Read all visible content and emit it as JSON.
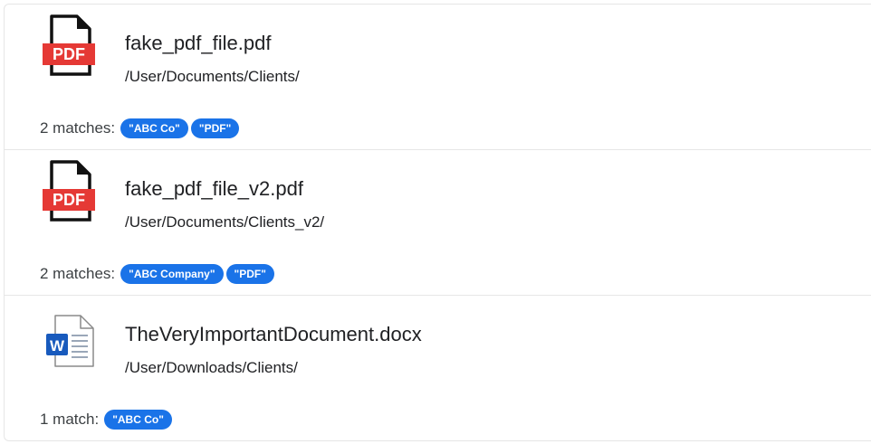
{
  "results": [
    {
      "icon": "pdf-file-icon",
      "icon_badge": "PDF",
      "file_name": "fake_pdf_file.pdf",
      "path": "/User/Documents/Clients/",
      "match_label": "2 matches:",
      "chips": [
        "\"ABC Co\"",
        "\"PDF\""
      ]
    },
    {
      "icon": "pdf-file-icon",
      "icon_badge": "PDF",
      "file_name": "fake_pdf_file_v2.pdf",
      "path": "/User/Documents/Clients_v2/",
      "match_label": "2 matches:",
      "chips": [
        "\"ABC Company\"",
        "\"PDF\""
      ]
    },
    {
      "icon": "word-file-icon",
      "icon_badge": "W",
      "file_name": "TheVeryImportantDocument.docx",
      "path": "/User/Downloads/Clients/",
      "match_label": "1 match:",
      "chips": [
        "\"ABC Co\""
      ]
    }
  ],
  "colors": {
    "chip": "#1a73e8",
    "pdf_red": "#e53935",
    "word_blue": "#185abd"
  }
}
